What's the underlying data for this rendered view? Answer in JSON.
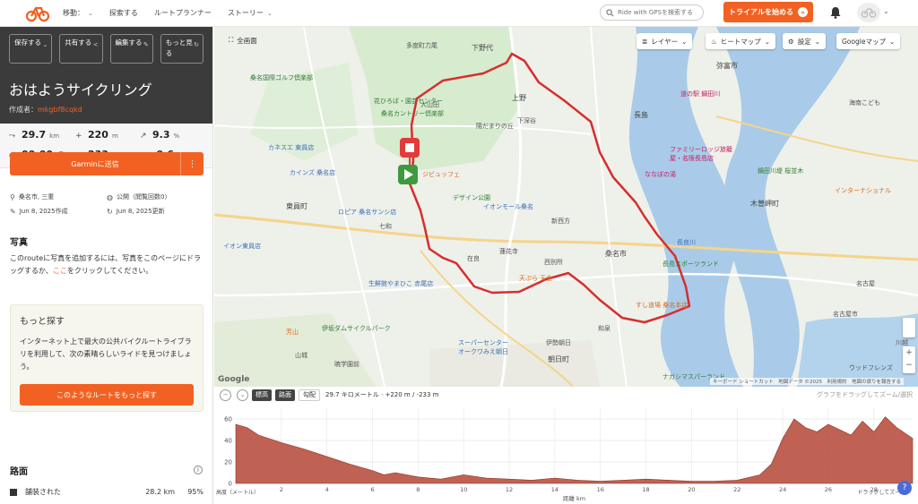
{
  "nav": {
    "items": [
      {
        "label": "移動：",
        "has_chevron": true
      },
      {
        "label": "探索する",
        "has_chevron": false
      },
      {
        "label": "ルートプランナー",
        "has_chevron": false
      },
      {
        "label": "ストーリー",
        "has_chevron": true
      }
    ],
    "search_placeholder": "Ride with GPSを検索する",
    "trial_label": "トライアルを始める",
    "trial_icon": "»"
  },
  "sidebar": {
    "actions": [
      {
        "label": "保存する",
        "icon": "⌄"
      },
      {
        "label": "共有する",
        "icon": "<"
      },
      {
        "label": "編集する",
        "icon": "✎"
      },
      {
        "label": "もっと見る",
        "icon": "↻"
      }
    ],
    "title": "おはようサイクリング",
    "author_prefix": "作成者：",
    "author": "mkgbf8cqkd",
    "stats": [
      {
        "icon": "⤳",
        "value": "29.7",
        "unit": "km"
      },
      {
        "icon": "+",
        "value": "220",
        "unit": "m"
      },
      {
        "icon": "↗",
        "value": "9.3",
        "unit": "%"
      },
      {
        "icon": "◷",
        "value": "00:00",
        "unit": ""
      },
      {
        "icon": "−",
        "value": "233",
        "unit": "m"
      },
      {
        "icon": "↘",
        "value": "-9.6",
        "unit": "%"
      }
    ],
    "garmin_label": "Garminに送信",
    "garmin_more": "⋮",
    "meta": [
      {
        "icon": "⚲",
        "text": "桑名市, 三重"
      },
      {
        "icon": "◍",
        "text": "公開（閲覧回数0）"
      },
      {
        "icon": "✎",
        "text": "Jun 8, 2025作成"
      },
      {
        "icon": "↻",
        "text": "Jun 8, 2025更新"
      }
    ],
    "photo_heading": "写真",
    "photo_text_1": "このrouteに写真を追加するには、写真をこのページにドラッグするか、",
    "photo_link": "ここ",
    "photo_text_2": "をクリックしてください。",
    "more": {
      "heading": "もっと探す",
      "text": "インターネット上で最大の公共バイクルートライブラリを利用して、次の素晴らしいライドを見つけましょう。",
      "button": "このようなルートをもっと探す"
    },
    "surface_heading": "路面",
    "surface_info": "i",
    "surface_rows": [
      {
        "name": "舗装された",
        "distance": "28.2 km",
        "percent": "95%"
      }
    ]
  },
  "map": {
    "controls": {
      "fullscreen": "全画面",
      "layer": "レイヤー",
      "heatmap": "ヒートマップ",
      "settings": "設定",
      "maptype": "Googleマップ"
    },
    "labels": [
      {
        "text": "下野代",
        "cls": "big"
      },
      {
        "text": "多度町力尾",
        "cls": ""
      },
      {
        "text": "弥富市",
        "cls": "big"
      },
      {
        "text": "桑名国際ゴルフ倶楽部",
        "cls": "green"
      },
      {
        "text": "花ひろば・園芸センター",
        "cls": "green"
      },
      {
        "text": "桑名カントリー倶楽部",
        "cls": "green"
      },
      {
        "text": "上野",
        "cls": "big"
      },
      {
        "text": "大山田",
        "cls": ""
      },
      {
        "text": "下深谷",
        "cls": ""
      },
      {
        "text": "長島",
        "cls": "big"
      },
      {
        "text": "道の駅 鍋田川",
        "cls": "pink"
      },
      {
        "text": "海南こども",
        "cls": ""
      },
      {
        "text": "カネスエ 東員店",
        "cls": "blue"
      },
      {
        "text": "陽だまりの丘",
        "cls": ""
      },
      {
        "text": "ファミリーロッジ旅籠",
        "cls": "pink"
      },
      {
        "text": "屋・名阪長島店",
        "cls": "pink"
      },
      {
        "text": "ななぽの湯",
        "cls": "pink"
      },
      {
        "text": "鍋田川堤 桜並木",
        "cls": "green"
      },
      {
        "text": "カインズ 桑名店",
        "cls": "blue"
      },
      {
        "text": "ジビュッフェ",
        "cls": "orange"
      },
      {
        "text": "デザイン公園",
        "cls": "green"
      },
      {
        "text": "東員町",
        "cls": "big"
      },
      {
        "text": "ロピア 桑名サンシ店",
        "cls": "blue"
      },
      {
        "text": "イオンモール桑名",
        "cls": "blue"
      },
      {
        "text": "新西方",
        "cls": ""
      },
      {
        "text": "木曽岬町",
        "cls": "big"
      },
      {
        "text": "インターナショナル",
        "cls": "orange"
      },
      {
        "text": "七和",
        "cls": ""
      },
      {
        "text": "桑名市",
        "cls": "big"
      },
      {
        "text": "イオン東員店",
        "cls": "blue"
      },
      {
        "text": "長良川",
        "cls": "blue"
      },
      {
        "text": "在良",
        "cls": ""
      },
      {
        "text": "西別所",
        "cls": ""
      },
      {
        "text": "蓮花寺",
        "cls": ""
      },
      {
        "text": "生鮮館やまひこ 赤尾店",
        "cls": "blue"
      },
      {
        "text": "天ぷら 天金",
        "cls": "orange"
      },
      {
        "text": "長島スポーツランド",
        "cls": "green"
      },
      {
        "text": "すし道場 桑名本店",
        "cls": "orange"
      },
      {
        "text": "名古屋",
        "cls": ""
      },
      {
        "text": "伊坂ダムサイクルパーク",
        "cls": "green"
      },
      {
        "text": "スーパーセンター",
        "cls": "blue"
      },
      {
        "text": "オークワみえ朝日",
        "cls": "blue"
      },
      {
        "text": "和泉",
        "cls": ""
      },
      {
        "text": "伊勢朝日",
        "cls": ""
      },
      {
        "text": "朝日町",
        "cls": "big"
      },
      {
        "text": "ナガシマスパーランド",
        "cls": "green"
      },
      {
        "text": "芳山",
        "cls": "orange"
      },
      {
        "text": "山城",
        "cls": ""
      },
      {
        "text": "暁学園前",
        "cls": ""
      },
      {
        "text": "ウッドフレンズ",
        "cls": ""
      },
      {
        "text": "川越",
        "cls": ""
      },
      {
        "text": "名古屋市",
        "cls": ""
      }
    ],
    "attribution": "キーボード ショートカット　地図データ ©2025　利用規約　地図の誤りを報告する",
    "google": "Google"
  },
  "elevation": {
    "zoom_out": "−",
    "zoom_in": "⌄",
    "tabs": [
      {
        "label": "標高",
        "active": true
      },
      {
        "label": "路面",
        "active": true
      },
      {
        "label": "勾配",
        "active": false
      }
    ],
    "summary": "29.7 キロメートル · +220 m / -233 m",
    "hint": "グラフをドラッグしてズーム/選択",
    "help": "?",
    "y_label": "高度（メートル）",
    "x_label": "距離 km",
    "x_hint": "ドラッグしてズーム/",
    "y_ticks": [
      60,
      40,
      20,
      0
    ],
    "x_ticks": [
      2,
      4,
      6,
      8,
      10,
      12,
      14,
      16,
      18,
      20,
      22,
      24,
      26,
      28
    ],
    "profile_color": "#b85040"
  },
  "chart_data": {
    "type": "area",
    "x": [
      0,
      0.5,
      1,
      2,
      3,
      4,
      5,
      6,
      6.5,
      7,
      8,
      9,
      10,
      11,
      12,
      13,
      14,
      15,
      16,
      17,
      18,
      19,
      20,
      21,
      22,
      23,
      23.5,
      24,
      24.5,
      25,
      25.5,
      26,
      26.5,
      27,
      27.5,
      28,
      28.5,
      29,
      29.7
    ],
    "y": [
      55,
      52,
      45,
      38,
      32,
      25,
      18,
      12,
      8,
      10,
      6,
      4,
      8,
      5,
      4,
      3,
      5,
      3,
      2,
      3,
      4,
      3,
      2,
      2,
      3,
      8,
      18,
      42,
      60,
      52,
      48,
      55,
      50,
      45,
      58,
      48,
      62,
      52,
      42
    ],
    "xlabel": "距離 km",
    "ylabel": "高度（メートル）",
    "xlim": [
      0,
      29.7
    ],
    "ylim": [
      0,
      70
    ],
    "grid": true
  }
}
